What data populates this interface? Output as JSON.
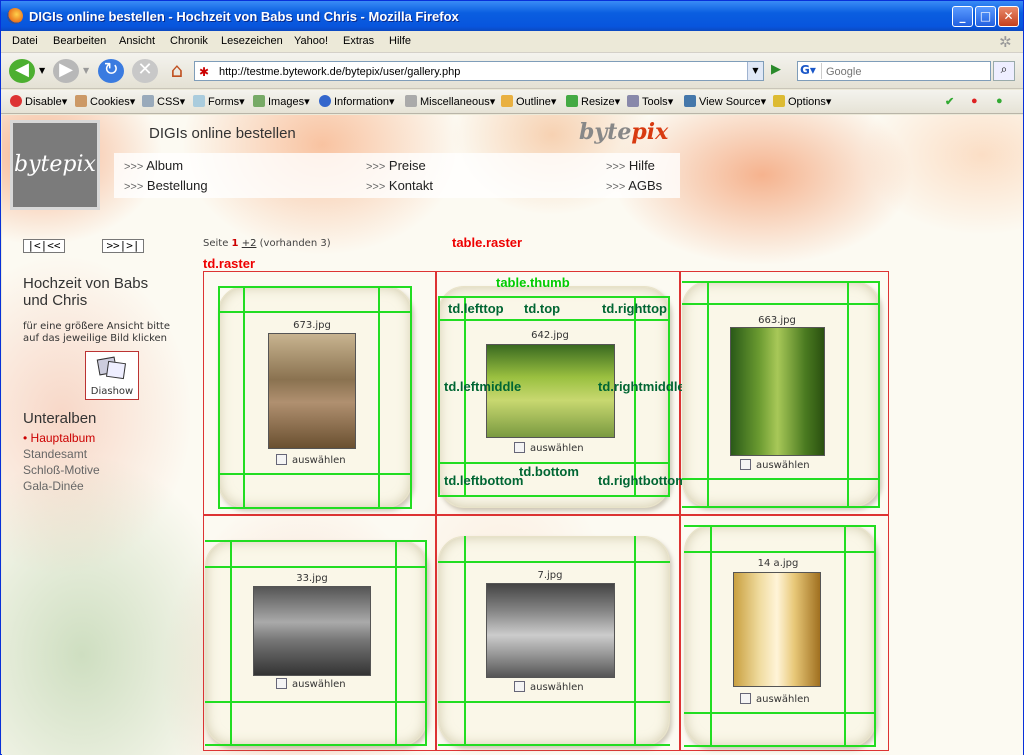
{
  "window": {
    "title": "DIGIs online bestellen - Hochzeit von Babs und Chris - Mozilla Firefox"
  },
  "menu": [
    "Datei",
    "Bearbeiten",
    "Ansicht",
    "Chronik",
    "Lesezeichen",
    "Yahoo!",
    "Extras",
    "Hilfe"
  ],
  "navigation": {
    "url": "http://testme.bytework.de/bytepix/user/gallery.php",
    "search_placeholder": "Google"
  },
  "devtoolbar": [
    "Disable",
    "Cookies",
    "CSS",
    "Forms",
    "Images",
    "Information",
    "Miscellaneous",
    "Outline",
    "Resize",
    "Tools",
    "View Source",
    "Options"
  ],
  "site": {
    "title": "DIGIs online bestellen",
    "logo": "bytepix",
    "brand_a": "byte",
    "brand_b": "pix",
    "nav": {
      "prefix": ">>>",
      "album": "Album",
      "preise": "Preise",
      "hilfe": "Hilfe",
      "bestellung": "Bestellung",
      "kontakt": "Kontakt",
      "agbs": "AGBs"
    }
  },
  "sidebar": {
    "first": "|<|<<",
    "last": ">>|>|",
    "gallery_title": "Hochzeit von Babs und Chris",
    "description": "für eine größere Ansicht bitte auf das jeweilige Bild klicken",
    "diashow": "Diashow",
    "unteralben_title": "Unteralben",
    "albums": [
      {
        "label": "Hauptalbum",
        "current": true
      },
      {
        "label": "Standesamt",
        "current": false
      },
      {
        "label": "Schloß-Motive",
        "current": false
      },
      {
        "label": "Gala-Dinée",
        "current": false
      }
    ]
  },
  "pageinfo": {
    "prefix": "Seite",
    "current": "1",
    "next": "+2",
    "total": "(vorhanden 3)"
  },
  "annotations": {
    "table_raster": "table.raster",
    "td_raster": "td.raster",
    "table_thumb": "table.thumb",
    "td_lefttop": "td.lefttop",
    "td_top": "td.top",
    "td_righttop": "td.righttop",
    "td_leftmiddle": "td.leftmiddle",
    "td_rightmiddle": "td.rightmiddle",
    "td_bottom": "td.bottom",
    "td_leftbottom": "td.leftbottom",
    "td_rightbottom": "td.rightbottom"
  },
  "thumbs": [
    {
      "file": "673.jpg",
      "select": "auswählen"
    },
    {
      "file": "642.jpg",
      "select": "auswählen"
    },
    {
      "file": "663.jpg",
      "select": "auswählen"
    },
    {
      "file": "33.jpg",
      "select": "auswählen"
    },
    {
      "file": "7.jpg",
      "select": "auswählen"
    },
    {
      "file": "14 a.jpg",
      "select": "auswählen"
    }
  ]
}
